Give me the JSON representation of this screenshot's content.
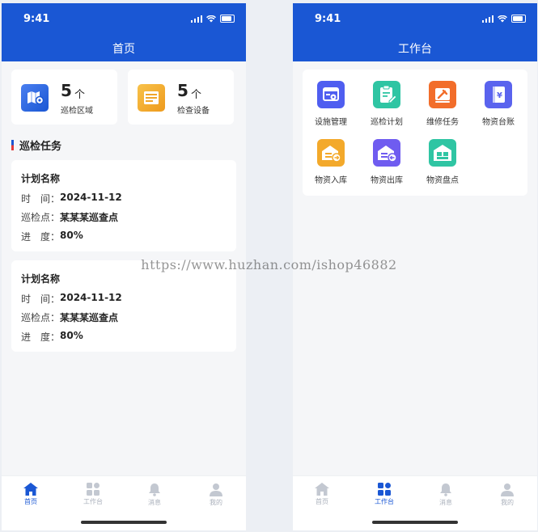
{
  "watermark": "https://www.huzhan.com/ishop46882",
  "status": {
    "time": "9:41"
  },
  "home": {
    "title": "首页",
    "stats": [
      {
        "value": "5",
        "unit": "个",
        "label": "巡检区域",
        "icon": "map-pin-icon"
      },
      {
        "value": "5",
        "unit": "个",
        "label": "检查设备",
        "icon": "device-list-icon"
      }
    ],
    "section_title": "巡检任务",
    "tasks": [
      {
        "name": "计划名称",
        "time_label": "时　间：",
        "time": "2024-11-12",
        "point_label": "巡检点：",
        "point": "某某某巡查点",
        "progress_label": "进　度：",
        "progress": "80%"
      },
      {
        "name": "计划名称",
        "time_label": "时　间：",
        "time": "2024-11-12",
        "point_label": "巡检点：",
        "point": "某某某巡查点",
        "progress_label": "进　度：",
        "progress": "80%"
      }
    ]
  },
  "work": {
    "title": "工作台",
    "items": [
      {
        "label": "设施管理",
        "icon": "facility-settings-icon",
        "color": "#4f5ef0"
      },
      {
        "label": "巡检计划",
        "icon": "clipboard-edit-icon",
        "color": "#2fc5a3"
      },
      {
        "label": "维修任务",
        "icon": "repair-tool-icon",
        "color": "#f26d2a"
      },
      {
        "label": "物资台账",
        "icon": "ledger-book-icon",
        "color": "#5a63ee"
      },
      {
        "label": "物资入库",
        "icon": "warehouse-in-icon",
        "color": "#f3a92b"
      },
      {
        "label": "物资出库",
        "icon": "warehouse-out-icon",
        "color": "#6f5cf0"
      },
      {
        "label": "物资盘点",
        "icon": "inventory-icon",
        "color": "#2fc5a3"
      }
    ]
  },
  "tabs": [
    {
      "label": "首页",
      "icon": "home-icon"
    },
    {
      "label": "工作台",
      "icon": "grid-icon"
    },
    {
      "label": "消息",
      "icon": "bell-icon"
    },
    {
      "label": "我的",
      "icon": "user-icon"
    }
  ],
  "colors": {
    "primary": "#1a57d4",
    "tab_inactive": "#aab0bb",
    "accent_red": "#e23b3b"
  }
}
